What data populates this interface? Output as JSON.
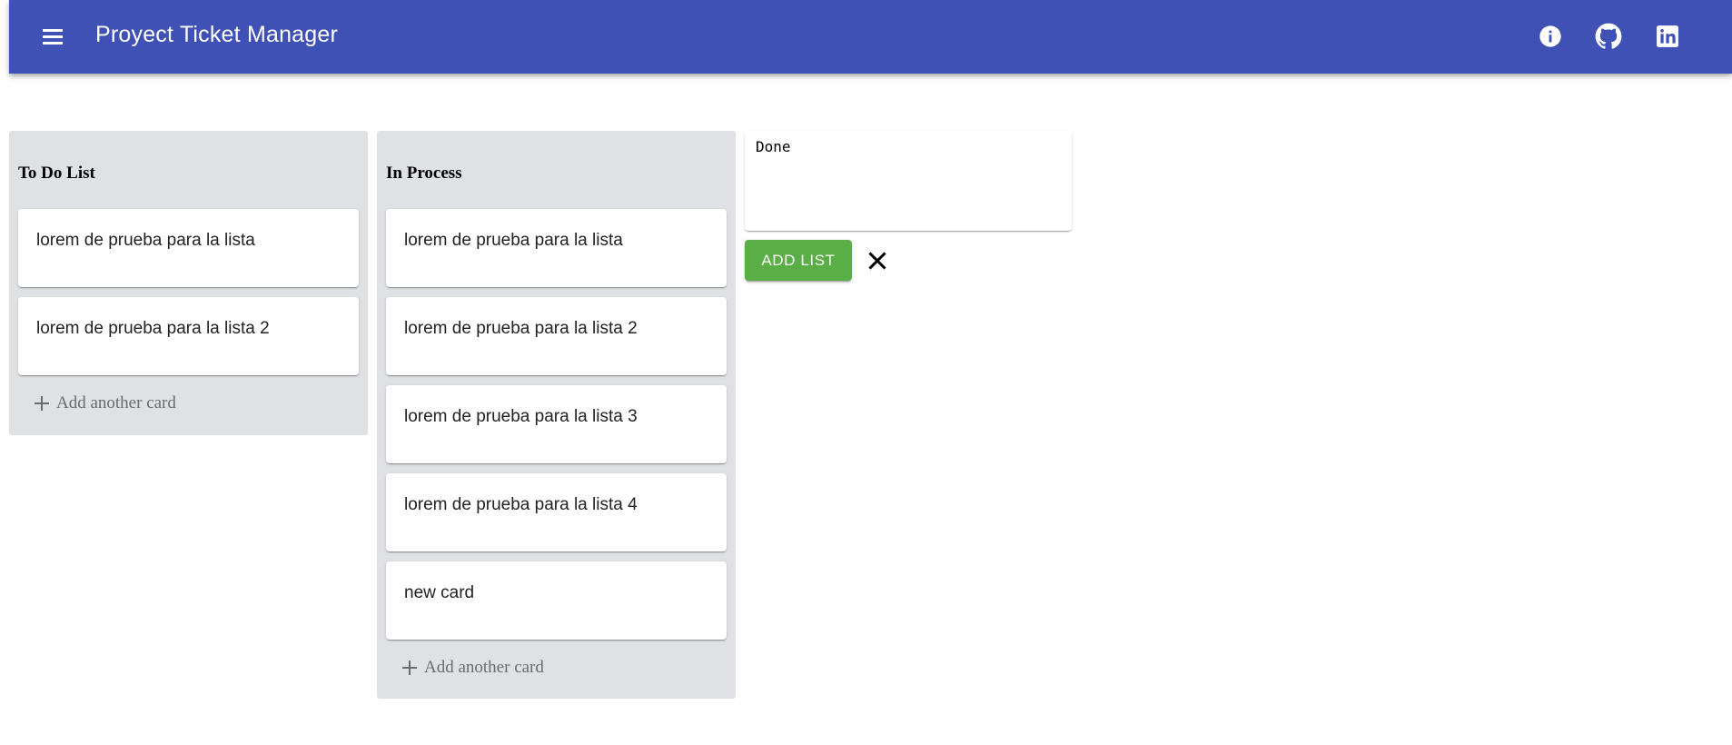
{
  "header": {
    "title": "Proyect Ticket Manager",
    "background": "#3f51b5",
    "menu_icon": "menu-icon",
    "right_icons": [
      "info-icon",
      "github-icon",
      "linkedin-icon"
    ]
  },
  "lists": [
    {
      "title": "To Do List",
      "cards": [
        "lorem de prueba para la lista",
        "lorem de prueba para la lista 2"
      ],
      "add_card_label": "Add another card"
    },
    {
      "title": "In Process",
      "cards": [
        "lorem de prueba para la lista",
        "lorem de prueba para la lista 2",
        "lorem de prueba para la lista 3",
        "lorem de prueba para la lista 4",
        "new card"
      ],
      "add_card_label": "Add another card"
    }
  ],
  "new_list": {
    "value": "Done",
    "button_label": "ADD LIST",
    "button_color": "#5aae46",
    "cancel_icon": "close-icon"
  },
  "colors": {
    "list_background": "#dfe1e4"
  }
}
